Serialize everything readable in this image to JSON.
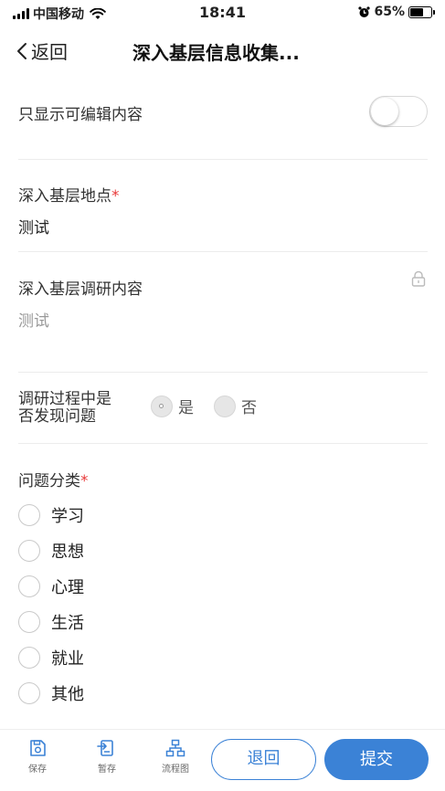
{
  "status_bar": {
    "carrier": "中国移动",
    "time": "18:41",
    "battery": "65%",
    "battery_level": 0.65
  },
  "nav": {
    "back_label": "返回",
    "title": "深入基层信息收集..."
  },
  "form": {
    "editable_only": {
      "label": "只显示可编辑内容",
      "on": false
    },
    "location": {
      "label": "深入基层地点",
      "required_mark": "*",
      "value": "测试"
    },
    "research_content": {
      "label": "深入基层调研内容",
      "value": "测试",
      "locked": true
    },
    "problem_found": {
      "label_line1": "调研过程中是",
      "label_line2": "否发现问题",
      "options": [
        "是",
        "否"
      ]
    },
    "category": {
      "label": "问题分类",
      "required_mark": "*",
      "options": [
        "学习",
        "思想",
        "心理",
        "生活",
        "就业",
        "其他"
      ]
    }
  },
  "bottom_bar": {
    "save": "保存",
    "draft": "暂存",
    "flowchart": "流程图",
    "return_button": "退回",
    "submit_button": "提交"
  },
  "colors": {
    "primary": "#3b82d6",
    "required": "#e83a3a"
  }
}
